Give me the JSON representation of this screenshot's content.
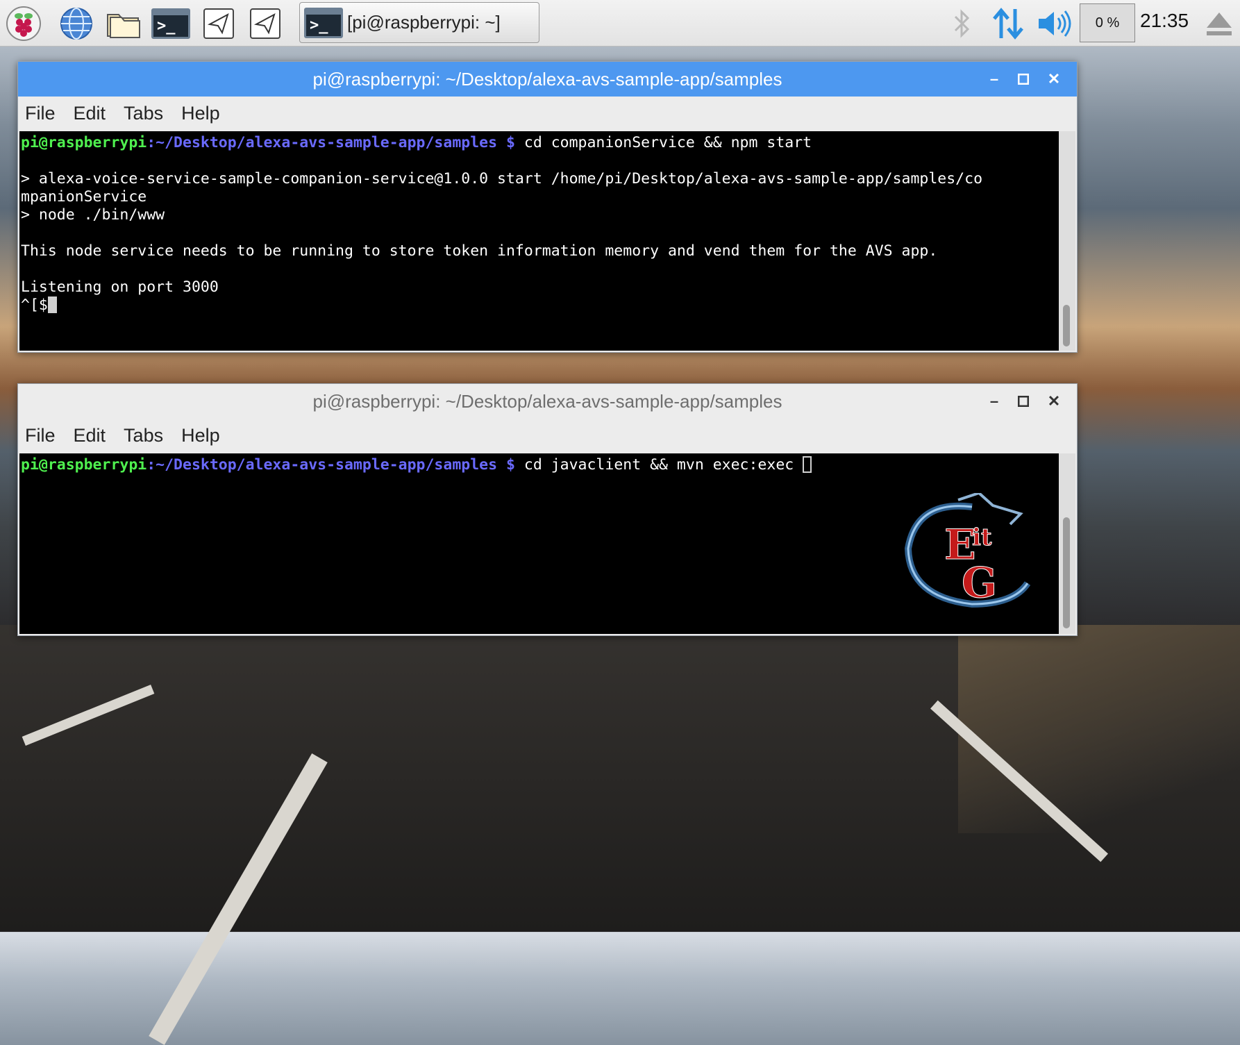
{
  "taskbar": {
    "task_label": "[pi@raspberrypi: ~]",
    "cpu_value": "0 %",
    "clock": "21:35"
  },
  "windows": [
    {
      "title": "pi@raspberrypi: ~/Desktop/alexa-avs-sample-app/samples",
      "menu": [
        "File",
        "Edit",
        "Tabs",
        "Help"
      ],
      "prompt_user": "pi@raspberrypi",
      "prompt_path": ":~/Desktop/alexa-avs-sample-app/samples",
      "prompt_symbol": " $",
      "command": " cd companionService && npm start",
      "output_lines": [
        "",
        "> alexa-voice-service-sample-companion-service@1.0.0 start /home/pi/Desktop/alexa-avs-sample-app/samples/co",
        "mpanionService",
        "> node ./bin/www",
        "",
        "This node service needs to be running to store token information memory and vend them for the AVS app.",
        "",
        "Listening on port 3000"
      ],
      "last_line": "^[$"
    },
    {
      "title": "pi@raspberrypi: ~/Desktop/alexa-avs-sample-app/samples",
      "menu": [
        "File",
        "Edit",
        "Tabs",
        "Help"
      ],
      "prompt_user": "pi@raspberrypi",
      "prompt_path": ":~/Desktop/alexa-avs-sample-app/samples",
      "prompt_symbol": " $",
      "command": " cd javaclient && mvn exec:exec "
    }
  ],
  "logo_text": [
    "E",
    "it",
    "G"
  ]
}
